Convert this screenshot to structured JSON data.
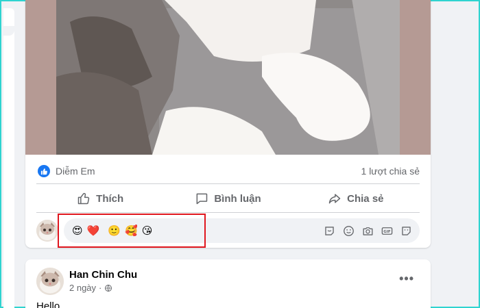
{
  "post1": {
    "reaction_summary": "Diễm Em",
    "share_count": "1 lượt chia sẻ",
    "actions": {
      "like": "Thích",
      "comment": "Bình luận",
      "share": "Chia sẻ"
    },
    "composer_emojis": [
      "😍",
      "❤️",
      "🙂",
      "🥰",
      "😘"
    ]
  },
  "post2": {
    "author": "Han Chin Chu",
    "timestamp": "2 ngày",
    "separator": "·",
    "text": "Hello"
  },
  "colors": {
    "accent": "#1877f2",
    "highlight": "#e0161e",
    "frame": "#2fd4d0"
  },
  "icons": [
    "like-icon",
    "comment-icon",
    "share-icon",
    "sticker-comment-icon",
    "emoji-icon",
    "camera-icon",
    "gif-icon",
    "sticker-icon",
    "globe-icon",
    "more-icon"
  ]
}
